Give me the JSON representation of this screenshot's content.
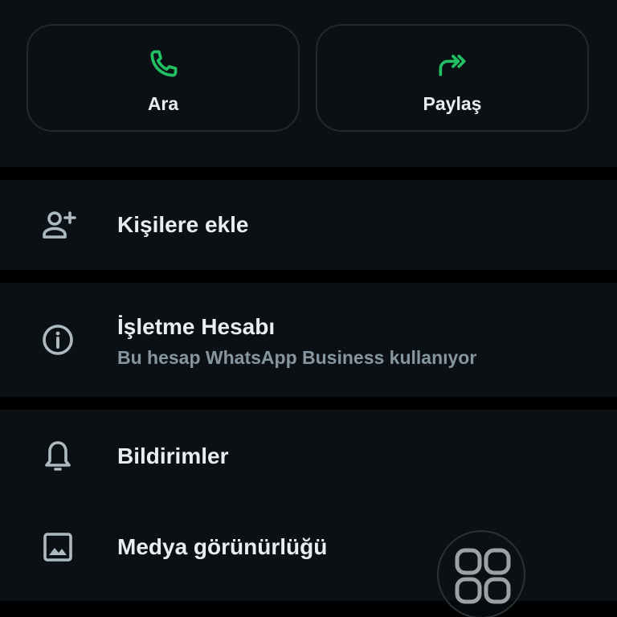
{
  "actions": {
    "call": {
      "label": "Ara",
      "icon": "phone-icon"
    },
    "share": {
      "label": "Paylaş",
      "icon": "forward-icon"
    }
  },
  "rows": {
    "add_contact": {
      "title": "Kişilere ekle",
      "icon": "add-person-icon"
    },
    "business": {
      "title": "İşletme Hesabı",
      "subtitle": "Bu hesap WhatsApp Business kullanıyor",
      "icon": "info-icon"
    },
    "notifications": {
      "title": "Bildirimler",
      "icon": "bell-icon"
    },
    "media_visibility": {
      "title": "Medya görünürlüğü",
      "icon": "image-icon"
    }
  },
  "floating": {
    "icon": "grid-icon"
  },
  "colors": {
    "accent": "#21c063",
    "background": "#0b1014",
    "text": "#e9edef",
    "secondary_text": "#8696a0"
  }
}
